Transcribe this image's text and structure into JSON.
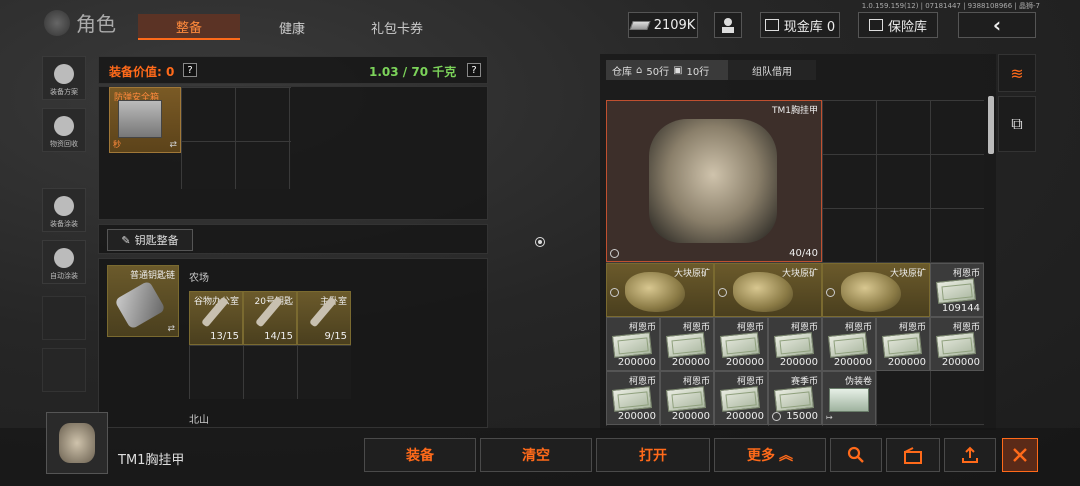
{
  "version": "1.0.159.159(12) | 07181447 | 9388108966 | 晶狮-7",
  "header": {
    "title": "角色",
    "tabs": [
      "整备",
      "健康",
      "礼包卡券"
    ],
    "money": "2109K",
    "cash_label": "现金库 0",
    "vault_label": "保险库"
  },
  "sidebar": [
    "装备方案",
    "物资回收",
    "装备涂装",
    "自动涂装"
  ],
  "loadout": {
    "value_label": "装备价值: 0",
    "weight": "1.03 / 70 千克",
    "case_name": "防弹安全箱",
    "case_badge": "秒"
  },
  "keys": {
    "header": "钥匙整备",
    "chain_name": "普通钥匙链",
    "section1": "农场",
    "section2": "北山",
    "items": [
      {
        "name": "谷物办公室",
        "count": "13/15"
      },
      {
        "name": "20号钥匙",
        "count": "14/15"
      },
      {
        "name": "主卧室",
        "count": "9/15"
      }
    ]
  },
  "warehouse": {
    "tab_label": "仓库",
    "rows1": "50行",
    "rows2": "10行",
    "team_tab": "组队借用",
    "armor": {
      "name": "TM1胸挂甲",
      "count": "40/40"
    },
    "ore": [
      {
        "name": "大块原矿"
      },
      {
        "name": "大块原矿"
      },
      {
        "name": "大块原矿"
      }
    ],
    "coin_row1": {
      "name": "柯恩币",
      "count": "109144"
    },
    "coins": [
      {
        "name": "柯恩币",
        "count": "200000"
      },
      {
        "name": "柯恩币",
        "count": "200000"
      },
      {
        "name": "柯恩币",
        "count": "200000"
      },
      {
        "name": "柯恩币",
        "count": "200000"
      },
      {
        "name": "柯恩币",
        "count": "200000"
      },
      {
        "name": "柯恩币",
        "count": "200000"
      },
      {
        "name": "柯恩币",
        "count": "200000"
      },
      {
        "name": "柯恩币",
        "count": "200000"
      },
      {
        "name": "柯恩币",
        "count": "200000"
      },
      {
        "name": "柯恩币",
        "count": "200000"
      }
    ],
    "season_coin": {
      "name": "赛季币",
      "count": "15000"
    },
    "disguise": {
      "name": "伪装卷"
    }
  },
  "footer": {
    "selected": "TM1胸挂甲",
    "buttons": [
      "装备",
      "清空",
      "打开",
      "更多"
    ]
  },
  "colors": {
    "accent": "#ff6a1a",
    "weight": "#7cd35a"
  }
}
